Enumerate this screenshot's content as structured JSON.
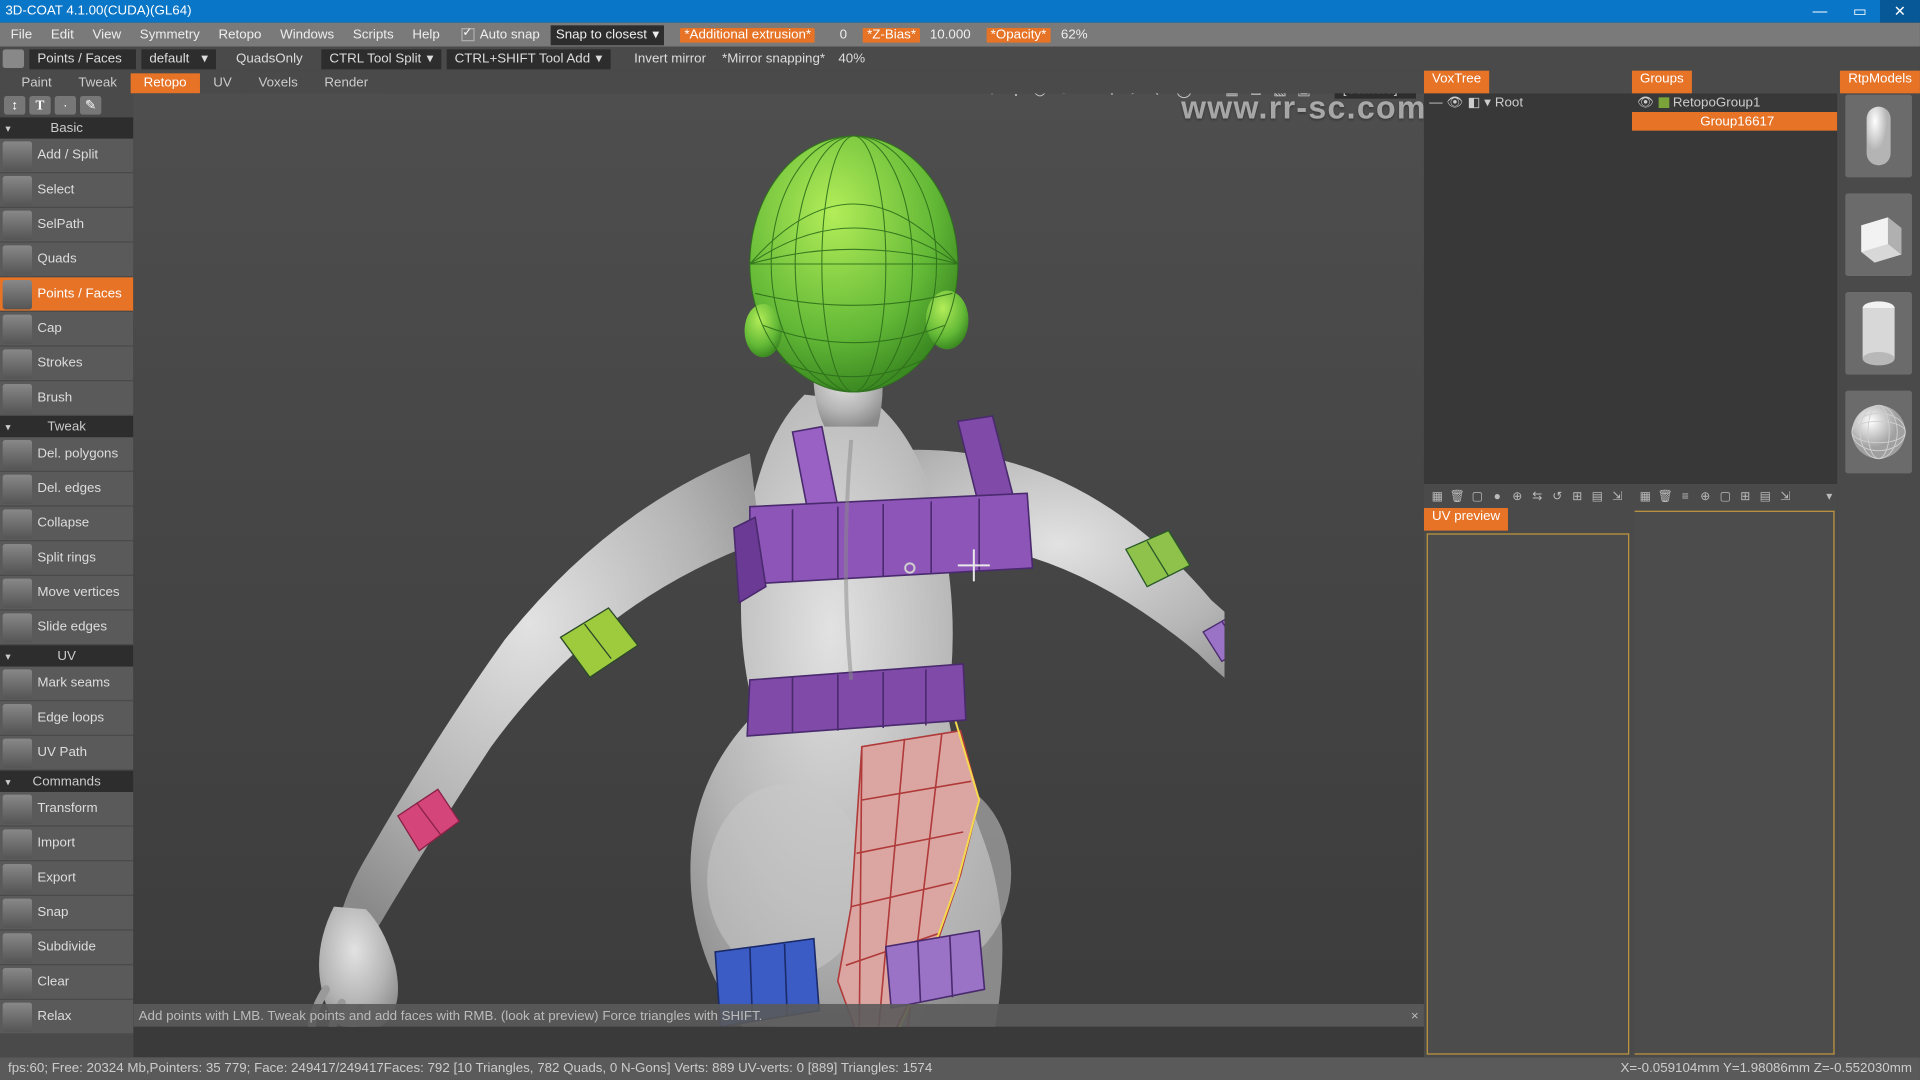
{
  "title": "3D-COAT 4.1.00(CUDA)(GL64)",
  "menubar": {
    "items": [
      "File",
      "Edit",
      "View",
      "Symmetry",
      "Retopo",
      "Windows",
      "Scripts",
      "Help"
    ],
    "autosnap_label": "Auto snap",
    "snap_label": "Snap to closest",
    "additional_extrusion_label": "*Additional extrusion*",
    "additional_extrusion_value": "0",
    "zbias_label": "*Z-Bias*",
    "zbias_value": "10.000",
    "opacity_label": "*Opacity*",
    "opacity_value": "62%"
  },
  "menubar2": {
    "mode": "Points / Faces",
    "preset": "default",
    "quadsonly": "QuadsOnly",
    "ctrl": "CTRL Tool Split",
    "ctrlshift": "CTRL+SHIFT Tool Add",
    "invert": "Invert mirror",
    "mirror_label": "*Mirror snapping*",
    "mirror_value": "40%"
  },
  "tabs": [
    "Paint",
    "Tweak",
    "Retopo",
    "UV",
    "Voxels",
    "Render"
  ],
  "tabs_active": 2,
  "tool_groups": [
    {
      "title": "Basic",
      "items": [
        "Add / Split",
        "Select",
        "SelPath",
        "Quads",
        "Points / Faces",
        "Cap",
        "Strokes",
        "Brush"
      ],
      "active": 4
    },
    {
      "title": "Tweak",
      "items": [
        "Del. polygons",
        "Del. edges",
        "Collapse",
        "Split rings",
        "Move vertices",
        "Slide edges"
      ]
    },
    {
      "title": "UV",
      "items": [
        "Mark seams",
        "Edge loops",
        "UV Path"
      ]
    },
    {
      "title": "Commands",
      "items": [
        "Transform",
        "Import",
        "Export",
        "Snap",
        "Subdivide",
        "Clear",
        "Relax"
      ]
    }
  ],
  "camera_label": "[Camera]",
  "watermark": "www.rr-sc.com",
  "voxtree": {
    "tab": "VoxTree",
    "root": "Root"
  },
  "groups": {
    "tab": "Groups",
    "group1": "RetopoGroup1",
    "group2": "Group16617"
  },
  "rtpmodels_tab": "RtpModels",
  "uvpreview_tab": "UV preview",
  "vp_hint": "Add points with LMB. Tweak points and add faces with RMB. (look at preview)  Force triangles with SHIFT.",
  "status": {
    "left": "fps:60;  Free: 20324 Mb,Pointers: 35 779; Face: 249417/249417Faces: 792 [10 Triangles, 782 Quads, 0 N-Gons] Verts: 889   UV-verts: 0 [889] Triangles: 1574",
    "right": "X=-0.059104mm  Y=1.98086mm  Z=-0.552030mm"
  }
}
